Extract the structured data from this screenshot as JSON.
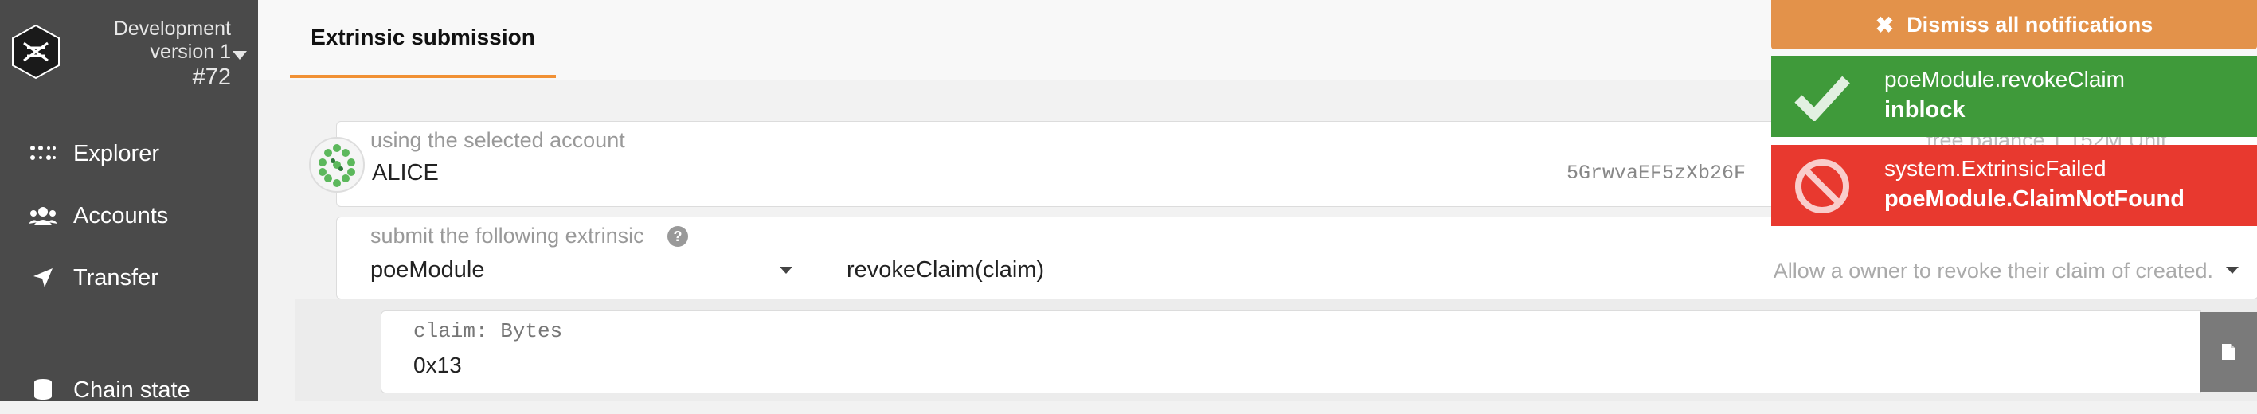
{
  "sidebar": {
    "chain": {
      "name": "Development",
      "version": "version 1",
      "block": "#72"
    },
    "items": [
      {
        "label": "Explorer",
        "icon": "explorer-icon"
      },
      {
        "label": "Accounts",
        "icon": "users-icon"
      },
      {
        "label": "Transfer",
        "icon": "send-icon"
      },
      {
        "label": "Chain state",
        "icon": "database-icon"
      }
    ]
  },
  "header": {
    "tab": "Extrinsic submission"
  },
  "account": {
    "label": "using the selected account",
    "name": "ALICE",
    "address": "5GrwvaEF5zXb26F",
    "balance_label": "free balance 1.152M Unit"
  },
  "extrinsic": {
    "label": "submit the following extrinsic",
    "module": "poeModule",
    "method": "revokeClaim(claim)",
    "description": "Allow a owner to revoke their claim of created."
  },
  "param": {
    "label": "claim: Bytes",
    "value": "0x13"
  },
  "notifications": {
    "dismiss_label": "Dismiss all notifications",
    "items": [
      {
        "title": "poeModule.revokeClaim",
        "status": "inblock",
        "color": "#3f9a3a",
        "icon": "check-icon"
      },
      {
        "title": "system.ExtrinsicFailed",
        "status": "poeModule.ClaimNotFound",
        "color": "#e8392f",
        "icon": "ban-icon"
      }
    ]
  },
  "colors": {
    "accent": "#f19135",
    "sidebar": "#4a4a4a",
    "success": "#3f9a3a",
    "error": "#e8392f",
    "dismiss": "#e3924a"
  }
}
